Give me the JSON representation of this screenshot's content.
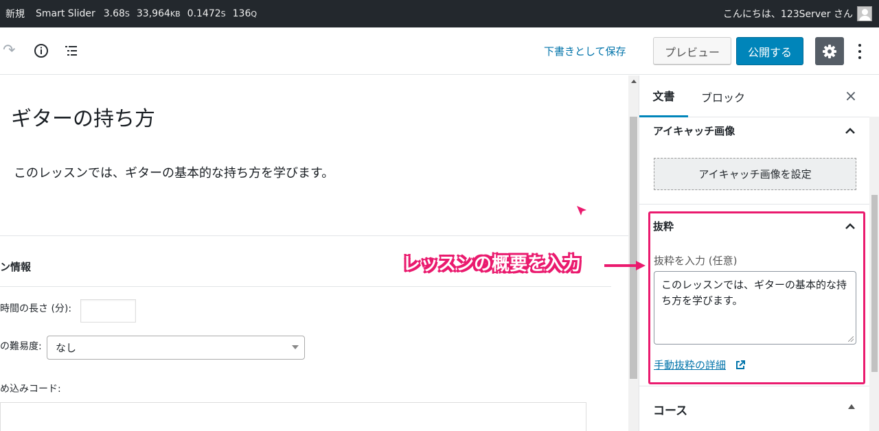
{
  "adminbar": {
    "new_label": "新規",
    "plugin_label": "Smart Slider",
    "stats": [
      {
        "value": "3.68",
        "unit": "S"
      },
      {
        "value": "33,964",
        "unit": "KB"
      },
      {
        "value": "0.1472",
        "unit": "S"
      },
      {
        "value": "136",
        "unit": "Q"
      }
    ],
    "greeting": "こんにちは、123Server さん"
  },
  "header": {
    "draft_label": "下書きとして保存",
    "preview_label": "プレビュー",
    "publish_label": "公開する"
  },
  "main": {
    "title": "ギターの持ち方",
    "paragraph": "このレッスンでは、ギターの基本的な持ち方を学びます。",
    "meta_heading": "ン情報",
    "length_label": "時間の長さ (分):",
    "difficulty_label": "の難易度:",
    "difficulty_value": "なし",
    "embed_label": "め込みコード:"
  },
  "sidebar": {
    "tabs": [
      {
        "label": "文書"
      },
      {
        "label": "ブロック"
      }
    ],
    "close_glyph": "×",
    "featured_title": "アイキャッチ画像",
    "featured_button": "アイキャッチ画像を設定",
    "excerpt_title": "抜粋",
    "excerpt_label": "抜粋を入力 (任意)",
    "excerpt_value": "このレッスンでは、ギターの基本的な持ち方を学びます。",
    "excerpt_link": "手動抜粋の詳細",
    "course_title": "コース"
  },
  "annotation": {
    "text": "レッスンの概要を入力",
    "color": "#ea1a6e"
  },
  "colors": {
    "accent": "#0085ba",
    "link": "#0073aa",
    "adminbar_bg": "#23282d"
  }
}
